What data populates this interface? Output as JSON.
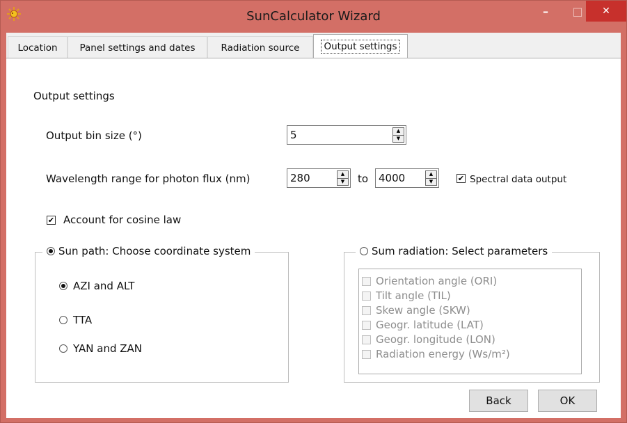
{
  "window": {
    "title": "SunCalculator Wizard",
    "minimize_glyph": "–",
    "maximize_glyph": "□",
    "close_glyph": "✕",
    "app_icon": "sun-icon",
    "accent_color": "#d36f66",
    "close_color": "#c7302c"
  },
  "tabs": [
    {
      "label": "Location"
    },
    {
      "label": "Panel settings and dates"
    },
    {
      "label": "Radiation source"
    },
    {
      "label": "Output settings",
      "selected": true
    }
  ],
  "panel": {
    "heading": "Output settings",
    "bin_size": {
      "label": "Output bin size (°)",
      "value": "5"
    },
    "wavelength": {
      "label": "Wavelength range for photon flux (nm)",
      "from_value": "280",
      "to_label": "to",
      "to_value": "4000"
    },
    "spectral_output": {
      "label": "Spectral data output",
      "checked": true
    },
    "cosine_law": {
      "label": "Account for cosine law",
      "checked": true
    },
    "sun_path": {
      "legend": "Sun path: Choose coordinate system",
      "selected": true,
      "options": [
        {
          "label": "AZI and ALT",
          "selected": true
        },
        {
          "label": "TTA",
          "selected": false
        },
        {
          "label": "YAN and ZAN",
          "selected": false
        }
      ]
    },
    "sum_radiation": {
      "legend": "Sum radiation: Select parameters",
      "selected": false,
      "items": [
        {
          "label": "Orientation angle (ORI)"
        },
        {
          "label": "Tilt angle (TIL)"
        },
        {
          "label": "Skew angle (SKW)"
        },
        {
          "label": "Geogr. latitude (LAT)"
        },
        {
          "label": "Geogr. longitude (LON)"
        },
        {
          "label": "Radiation energy (Ws/m²)"
        }
      ]
    }
  },
  "buttons": {
    "back": "Back",
    "ok": "OK"
  },
  "check_glyph": "✔"
}
